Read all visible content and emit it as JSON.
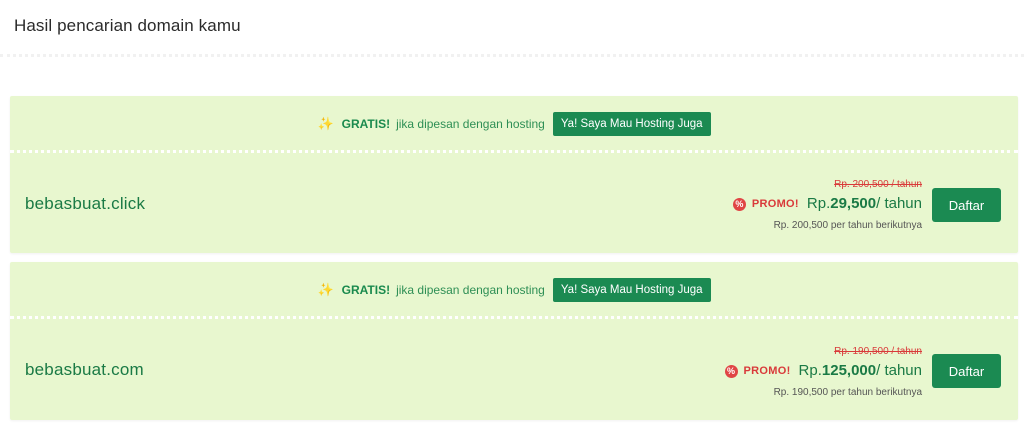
{
  "page": {
    "title": "Hasil pencarian domain kamu"
  },
  "results": [
    {
      "promo_bar": {
        "icon": "sparkle-icon",
        "gratis_label": "GRATIS!",
        "text": "jika dipesan dengan hosting",
        "button_label": "Ya! Saya Mau Hosting Juga"
      },
      "domain": "bebasbuat.click",
      "original_price": "Rp. 200,500 / tahun",
      "promo_label": "PROMO!",
      "currency": "Rp.",
      "price": "29,500",
      "period": "/ tahun",
      "renewal": "Rp. 200,500 per tahun berikutnya",
      "register_label": "Daftar"
    },
    {
      "promo_bar": {
        "icon": "sparkle-icon",
        "gratis_label": "GRATIS!",
        "text": "jika dipesan dengan hosting",
        "button_label": "Ya! Saya Mau Hosting Juga"
      },
      "domain": "bebasbuat.com",
      "original_price": "Rp. 190,500 / tahun",
      "promo_label": "PROMO!",
      "currency": "Rp.",
      "price": "125,000",
      "period": "/ tahun",
      "renewal": "Rp. 190,500 per tahun berikutnya",
      "register_label": "Daftar"
    }
  ],
  "colors": {
    "card_background": "#e8f7cf",
    "primary_green": "#1b8a52",
    "promo_red": "#d93a3a",
    "sparkle": "#f0a81e"
  }
}
